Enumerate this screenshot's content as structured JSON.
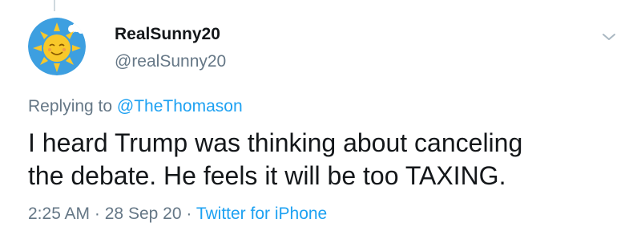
{
  "author": {
    "display_name": "RealSunny20",
    "handle": "@realSunny20",
    "avatar_icon": "sun-face-avatar-icon"
  },
  "menu": {
    "icon": "chevron-down-icon"
  },
  "reply": {
    "prefix": "Replying to",
    "mention": "@TheThomason"
  },
  "tweet": {
    "line1": "I heard Trump was thinking about canceling",
    "line2": "the debate. He feels it will be too TAXING."
  },
  "meta": {
    "time": "2:25 AM",
    "separator": "·",
    "date": "28 Sep 20",
    "source": "Twitter for iPhone"
  },
  "colors": {
    "text_primary": "#14171a",
    "text_secondary": "#657786",
    "link": "#1da1f2",
    "avatar_bg": "#3d9fe0",
    "sun": "#f8c82a"
  }
}
